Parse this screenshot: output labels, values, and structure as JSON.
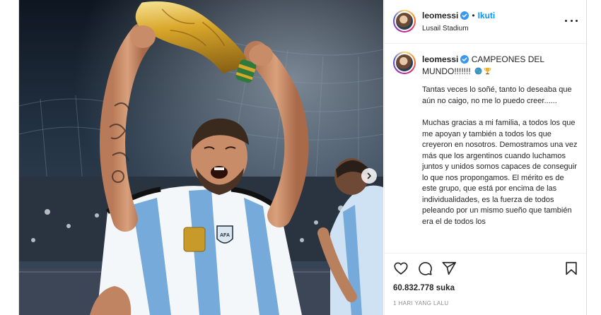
{
  "post": {
    "username": "leomessi",
    "follow_label": "Ikuti",
    "separator": "•",
    "location": "Lusail Stadium",
    "caption_title": "CAMPEONES DEL MUNDO!!!!!!!",
    "caption_paragraphs": [
      "Tantas veces lo soñé, tanto lo deseaba que aún no caigo, no me lo puedo creer......",
      "Muchas gracias a mi familia, a todos los que me apoyan y también a todos los que creyeron en nosotros. Demostramos una vez más que los argentinos cuando luchamos juntos y unidos somos capaces de conseguir lo que nos propongamos. El mérito es de este grupo, que está por encima de las individualidades, es la fuerza de todos peleando por un mismo sueño que también era el de todos los"
    ],
    "likes_count": "60.832.778",
    "likes_suffix": "suka",
    "timestamp": "1 HARI YANG LALU"
  },
  "icons": {
    "verified": "verified-badge-icon",
    "more": "more-options-icon",
    "like": "heart-icon",
    "comment": "comment-icon",
    "share": "paper-plane-icon",
    "save": "bookmark-icon",
    "carousel_next": "chevron-right-icon",
    "globe_emoji": "globe-emoji",
    "trophy_emoji": "trophy-emoji"
  },
  "colors": {
    "follow_blue": "#0095f6",
    "verified_blue": "#3897f0",
    "text": "#262626",
    "muted": "#8e8e8e",
    "albiceleste": "#75aadb"
  }
}
